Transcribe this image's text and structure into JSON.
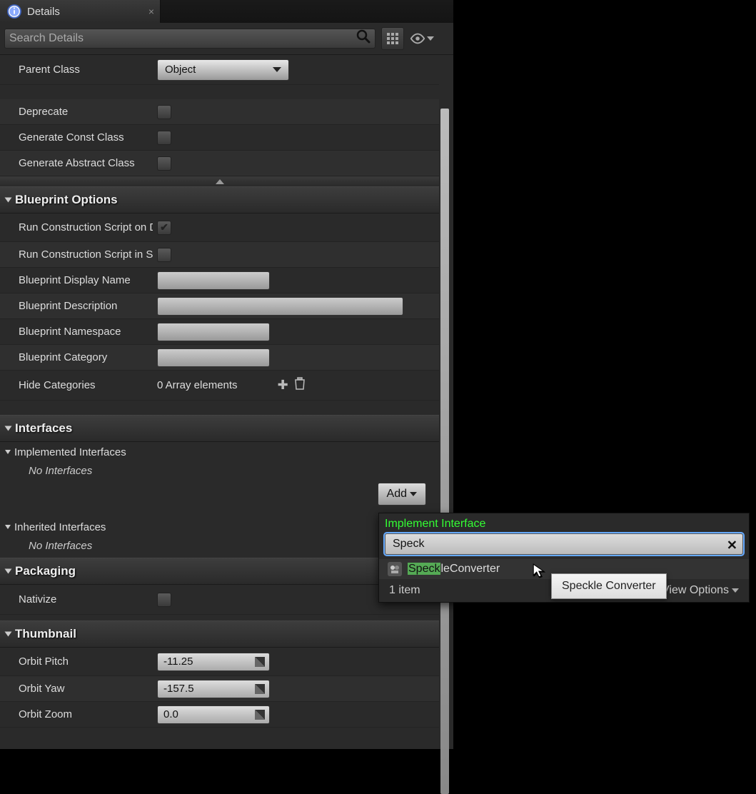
{
  "tab": {
    "title": "Details"
  },
  "search": {
    "placeholder": "Search Details"
  },
  "parentClass": {
    "label": "Parent Class",
    "value": "Object"
  },
  "checks": {
    "deprecate": "Deprecate",
    "genConst": "Generate Const Class",
    "genAbstract": "Generate Abstract Class"
  },
  "sections": {
    "bpOptions": "Blueprint Options",
    "interfaces": "Interfaces",
    "packaging": "Packaging",
    "thumbnail": "Thumbnail"
  },
  "bpOptions": {
    "runDrag": "Run Construction Script on Drag",
    "runSeq": "Run Construction Script in Sequencer",
    "displayName": "Blueprint Display Name",
    "description": "Blueprint Description",
    "namespace": "Blueprint Namespace",
    "category": "Blueprint Category",
    "hideCategories": "Hide Categories",
    "arrayElements": "0 Array elements"
  },
  "interfaces": {
    "implemented": "Implemented Interfaces",
    "inherited": "Inherited Interfaces",
    "none": "No Interfaces",
    "addBtn": "Add"
  },
  "packaging": {
    "nativize": "Nativize"
  },
  "thumbnail": {
    "orbitPitch": {
      "label": "Orbit Pitch",
      "value": "-11.25"
    },
    "orbitYaw": {
      "label": "Orbit Yaw",
      "value": "-157.5"
    },
    "orbitZoom": {
      "label": "Orbit Zoom",
      "value": "0.0"
    }
  },
  "popup": {
    "title": "Implement Interface",
    "searchValue": "Speck",
    "resultHighlight": "Speck",
    "resultRest": "leConverter",
    "count": "1 item",
    "viewOptions": "View Options"
  },
  "tooltip": "Speckle Converter"
}
